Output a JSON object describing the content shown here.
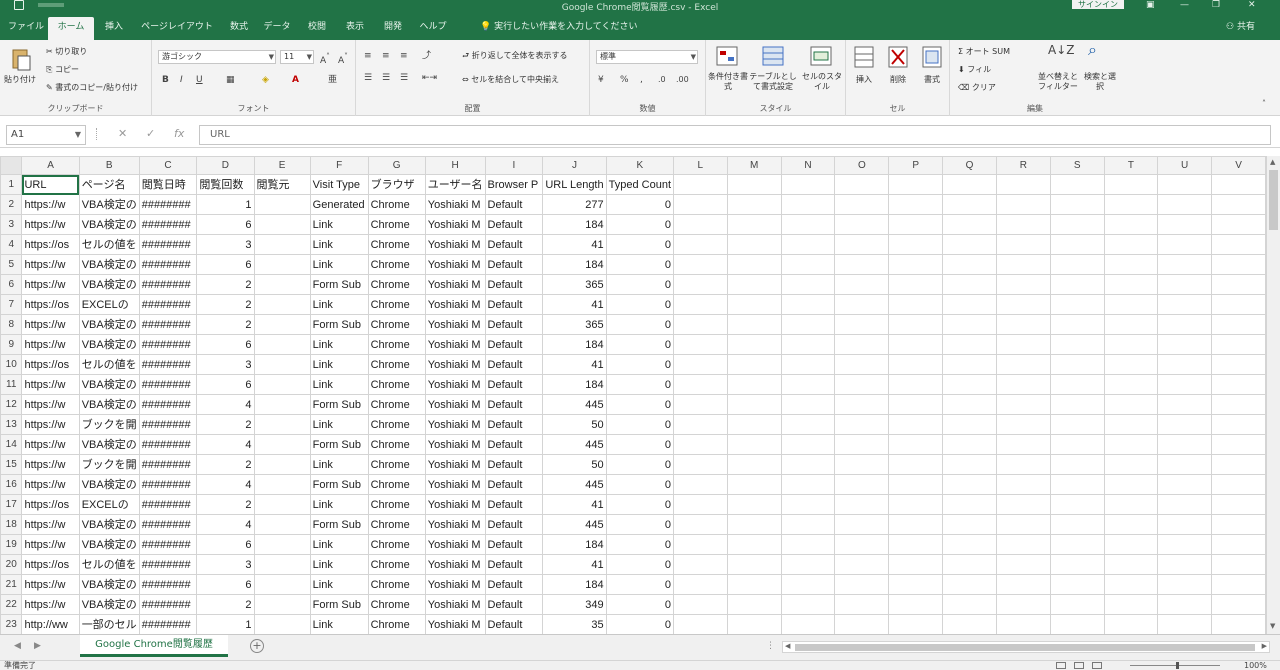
{
  "app": {
    "title": "Google Chrome閲覧履歴.csv - Excel",
    "signin": "サインイン",
    "window_controls": [
      "minimize-icon",
      "restore-icon",
      "close-icon"
    ]
  },
  "ribbon_tabs": [
    {
      "label": "ファイル",
      "active": false
    },
    {
      "label": "ホーム",
      "active": true
    },
    {
      "label": "挿入",
      "active": false
    },
    {
      "label": "ページレイアウト",
      "active": false
    },
    {
      "label": "数式",
      "active": false
    },
    {
      "label": "データ",
      "active": false
    },
    {
      "label": "校閲",
      "active": false
    },
    {
      "label": "表示",
      "active": false
    },
    {
      "label": "開発",
      "active": false
    },
    {
      "label": "ヘルプ",
      "active": false
    }
  ],
  "tell_me": "実行したい作業を入力してください",
  "share": "共有",
  "ribbon": {
    "clipboard": {
      "paste": "貼り付け",
      "cut": "切り取り",
      "copy": "コピー",
      "format_painter": "書式のコピー/貼り付け",
      "label": "クリップボード"
    },
    "font": {
      "name": "游ゴシック",
      "size": "11",
      "label": "フォント",
      "bold": "B",
      "italic": "I",
      "underline": "U"
    },
    "alignment": {
      "wrap": "折り返して全体を表示する",
      "merge": "セルを結合して中央揃え",
      "label": "配置"
    },
    "number": {
      "format": "標準",
      "label": "数値"
    },
    "styles": {
      "conditional": "条件付き書式",
      "table": "テーブルとして書式設定",
      "cell_styles": "セルのスタイル",
      "label": "スタイル"
    },
    "cells": {
      "insert": "挿入",
      "delete": "削除",
      "format": "書式",
      "label": "セル"
    },
    "editing": {
      "autosum": "オート SUM",
      "fill": "フィル",
      "clear": "クリア",
      "sort": "並べ替えとフィルター",
      "find": "検索と選択",
      "label": "編集"
    }
  },
  "formula_bar": {
    "name_box": "A1",
    "content": "URL"
  },
  "columns": [
    "A",
    "B",
    "C",
    "D",
    "E",
    "F",
    "G",
    "H",
    "I",
    "J",
    "K",
    "L",
    "M",
    "N",
    "O",
    "P",
    "Q",
    "R",
    "S",
    "T",
    "U",
    "V"
  ],
  "headers": [
    "URL",
    "ページ名",
    "閲覧日時",
    "閲覧回数",
    "閲覧元",
    "Visit Type",
    "ブラウザ",
    "ユーザー名",
    "Browser P",
    "URL Length",
    "Typed Count"
  ],
  "rows": [
    {
      "n": "2",
      "cells": [
        "https://w",
        "VBA検定の",
        "########",
        "1",
        "",
        "Generated",
        "Chrome",
        "Yoshiaki M",
        "Default",
        "277",
        "0"
      ]
    },
    {
      "n": "3",
      "cells": [
        "https://w",
        "VBA検定の",
        "########",
        "6",
        "",
        "Link",
        "Chrome",
        "Yoshiaki M",
        "Default",
        "184",
        "0"
      ]
    },
    {
      "n": "4",
      "cells": [
        "https://os",
        "セルの値を",
        "########",
        "3",
        "",
        "Link",
        "Chrome",
        "Yoshiaki M",
        "Default",
        "41",
        "0"
      ]
    },
    {
      "n": "5",
      "cells": [
        "https://w",
        "VBA検定の",
        "########",
        "6",
        "",
        "Link",
        "Chrome",
        "Yoshiaki M",
        "Default",
        "184",
        "0"
      ]
    },
    {
      "n": "6",
      "cells": [
        "https://w",
        "VBA検定の",
        "########",
        "2",
        "",
        "Form Sub",
        "Chrome",
        "Yoshiaki M",
        "Default",
        "365",
        "0"
      ]
    },
    {
      "n": "7",
      "cells": [
        "https://os",
        "EXCELの",
        "########",
        "2",
        "",
        "Link",
        "Chrome",
        "Yoshiaki M",
        "Default",
        "41",
        "0"
      ]
    },
    {
      "n": "8",
      "cells": [
        "https://w",
        "VBA検定の",
        "########",
        "2",
        "",
        "Form Sub",
        "Chrome",
        "Yoshiaki M",
        "Default",
        "365",
        "0"
      ]
    },
    {
      "n": "9",
      "cells": [
        "https://w",
        "VBA検定の",
        "########",
        "6",
        "",
        "Link",
        "Chrome",
        "Yoshiaki M",
        "Default",
        "184",
        "0"
      ]
    },
    {
      "n": "10",
      "cells": [
        "https://os",
        "セルの値を",
        "########",
        "3",
        "",
        "Link",
        "Chrome",
        "Yoshiaki M",
        "Default",
        "41",
        "0"
      ]
    },
    {
      "n": "11",
      "cells": [
        "https://w",
        "VBA検定の",
        "########",
        "6",
        "",
        "Link",
        "Chrome",
        "Yoshiaki M",
        "Default",
        "184",
        "0"
      ]
    },
    {
      "n": "12",
      "cells": [
        "https://w",
        "VBA検定の",
        "########",
        "4",
        "",
        "Form Sub",
        "Chrome",
        "Yoshiaki M",
        "Default",
        "445",
        "0"
      ]
    },
    {
      "n": "13",
      "cells": [
        "https://w",
        "ブックを開",
        "########",
        "2",
        "",
        "Link",
        "Chrome",
        "Yoshiaki M",
        "Default",
        "50",
        "0"
      ]
    },
    {
      "n": "14",
      "cells": [
        "https://w",
        "VBA検定の",
        "########",
        "4",
        "",
        "Form Sub",
        "Chrome",
        "Yoshiaki M",
        "Default",
        "445",
        "0"
      ]
    },
    {
      "n": "15",
      "cells": [
        "https://w",
        "ブックを開",
        "########",
        "2",
        "",
        "Link",
        "Chrome",
        "Yoshiaki M",
        "Default",
        "50",
        "0"
      ]
    },
    {
      "n": "16",
      "cells": [
        "https://w",
        "VBA検定の",
        "########",
        "4",
        "",
        "Form Sub",
        "Chrome",
        "Yoshiaki M",
        "Default",
        "445",
        "0"
      ]
    },
    {
      "n": "17",
      "cells": [
        "https://os",
        "EXCELの",
        "########",
        "2",
        "",
        "Link",
        "Chrome",
        "Yoshiaki M",
        "Default",
        "41",
        "0"
      ]
    },
    {
      "n": "18",
      "cells": [
        "https://w",
        "VBA検定の",
        "########",
        "4",
        "",
        "Form Sub",
        "Chrome",
        "Yoshiaki M",
        "Default",
        "445",
        "0"
      ]
    },
    {
      "n": "19",
      "cells": [
        "https://w",
        "VBA検定の",
        "########",
        "6",
        "",
        "Link",
        "Chrome",
        "Yoshiaki M",
        "Default",
        "184",
        "0"
      ]
    },
    {
      "n": "20",
      "cells": [
        "https://os",
        "セルの値を",
        "########",
        "3",
        "",
        "Link",
        "Chrome",
        "Yoshiaki M",
        "Default",
        "41",
        "0"
      ]
    },
    {
      "n": "21",
      "cells": [
        "https://w",
        "VBA検定の",
        "########",
        "6",
        "",
        "Link",
        "Chrome",
        "Yoshiaki M",
        "Default",
        "184",
        "0"
      ]
    },
    {
      "n": "22",
      "cells": [
        "https://w",
        "VBA検定の",
        "########",
        "2",
        "",
        "Form Sub",
        "Chrome",
        "Yoshiaki M",
        "Default",
        "349",
        "0"
      ]
    },
    {
      "n": "23",
      "cells": [
        "http://ww",
        "一部のセル",
        "########",
        "1",
        "",
        "Link",
        "Chrome",
        "Yoshiaki M",
        "Default",
        "35",
        "0"
      ]
    }
  ],
  "sheet_tab": "Google Chrome閲覧履歴",
  "status": {
    "ready": "準備完了",
    "zoom": "100%"
  },
  "colors": {
    "accent": "#217346",
    "grid": "#d4d4d4",
    "header_bg": "#f3f3f3"
  }
}
